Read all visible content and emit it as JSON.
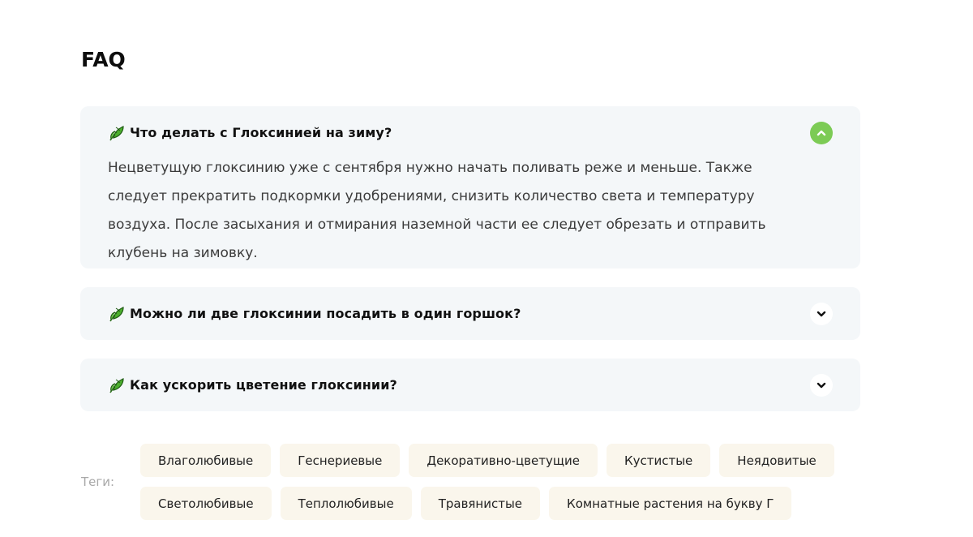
{
  "faq": {
    "title": "FAQ",
    "items": [
      {
        "question": "Что делать с Глоксинией на зиму?",
        "expanded": true,
        "answer": "Нецветущую глоксинию уже с сентября нужно начать поливать реже и меньше. Также следует прекратить подкормки удобрениями, снизить количество света и температуру воздуха. После засыхания и отмирания наземной части ее следует обрезать и отправить клубень на зимовку."
      },
      {
        "question": "Можно ли две глоксинии посадить в один горшок?",
        "expanded": false
      },
      {
        "question": "Как ускорить цветение глоксинии?",
        "expanded": false
      }
    ],
    "icons": {
      "item": "leaf-icon",
      "expanded_toggle": "chevron-up-icon",
      "collapsed_toggle": "chevron-down-icon"
    }
  },
  "tags": {
    "label": "Теги:",
    "row1": [
      "Влаголюбивые",
      "Геснериевые",
      "Декоративно-цветущие",
      "Кустистые",
      "Неядовитые"
    ],
    "row2": [
      "Светолюбивые",
      "Теплолюбивые",
      "Травянистые",
      "Комнатные растения на букву Г"
    ]
  },
  "colors": {
    "accent_green": "#7ccb55",
    "faq_background": "#f4f7f9",
    "tag_background": "#faf6ec",
    "muted_text": "#a8a8a8"
  }
}
